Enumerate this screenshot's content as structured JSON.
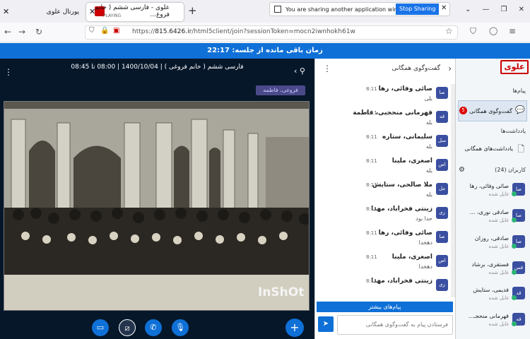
{
  "browser": {
    "tabs": [
      {
        "label": "پورتال علوی"
      },
      {
        "label": "علوی - فارسی ششم ( خانم فروغ...",
        "status": "PLAYING"
      }
    ],
    "share_notice": "You are sharing another application window.",
    "stop_sharing": "Stop Sharing",
    "url_host": "815.6426.ir",
    "url_rest": "/html5client/join?sessionToken=mocn2iwnhokh61w",
    "url_prefix": "https://"
  },
  "banner": {
    "text": "زمان باقی مانده از جلسه: 22:17"
  },
  "video": {
    "title": "فارسی ششم ( خانم فروغی ) | 1400/10/04 | 08:00 تا 08:45",
    "presenter": "فروغی، فاطمه",
    "watermark": "InShOt"
  },
  "chat": {
    "title": "گفت‌وگوی همگانی",
    "more_messages": "پیام‌های بیشتر",
    "input_placeholder": "فرستادن پیام به گفت‌وگوی همگانی",
    "messages": [
      {
        "name": "صائی وفائی، رها",
        "time": "8:11",
        "text": "بلی",
        "initials": "صا"
      },
      {
        "name": "قهرمانی منحجبی، فاطمة",
        "time": "8:11",
        "text": "بله",
        "initials": "قه"
      },
      {
        "name": "سلیمانی، ستاره",
        "time": "8:11",
        "text": "بله",
        "initials": "سل"
      },
      {
        "name": "اصغری، ملینا",
        "time": "8:11",
        "text": "بله",
        "initials": "اص"
      },
      {
        "name": "ملا صالحی، ستایش",
        "time": "8:11",
        "text": "بله",
        "initials": "مل"
      },
      {
        "name": "زینتی فخراباد، مهدا",
        "time": "8:11",
        "text": "حدا بود",
        "initials": "زی"
      },
      {
        "name": "صائی وفائی، رها",
        "time": "8:11",
        "text": "دهخدا",
        "initials": "صا"
      },
      {
        "name": "اصغری، ملینا",
        "time": "8:11",
        "text": "دهخدا",
        "initials": "اص"
      },
      {
        "name": "زینتی فخراباد، مهدا",
        "time": "8:11",
        "text": "",
        "initials": "زی"
      }
    ]
  },
  "sidebar": {
    "logo": "علوی",
    "messages_heading": "پیام‌ها",
    "public_chat": "گفت‌وگوی همگانی",
    "unread": "5",
    "notes_heading": "یادداشت‌ها",
    "public_notes": "یادداشت‌های همگانی",
    "users_heading": "کاربران (24)",
    "users": [
      {
        "name": "صائی وفائی، رها",
        "status": "غایل شده",
        "initials": "صا"
      },
      {
        "name": "صادقی نوری، ...",
        "status": "غایل شده",
        "initials": "صا"
      },
      {
        "name": "صادقی، روزان",
        "status": "غایل شده",
        "initials": "صا"
      },
      {
        "name": "فستقری، برشاد",
        "status": "غایل شده",
        "initials": "فس"
      },
      {
        "name": "فدیمی، ستایش",
        "status": "غایل شده",
        "initials": "قد"
      },
      {
        "name": "قهرمانی منحجـ...",
        "status": "غایل شده",
        "initials": "قه"
      }
    ]
  }
}
